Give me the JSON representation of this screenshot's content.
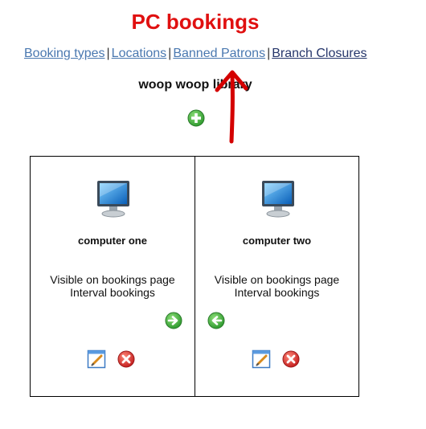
{
  "page": {
    "title": "PC bookings",
    "library_name": "woop woop library"
  },
  "nav": {
    "links": [
      {
        "label": "Booking types"
      },
      {
        "label": "Locations"
      },
      {
        "label": "Banned Patrons"
      },
      {
        "label": "Branch Closures"
      }
    ],
    "separator": "|"
  },
  "colors": {
    "title": "#e01010",
    "link": "#4a78b0",
    "link_visited": "#26366b",
    "add_green": "#3aa63a",
    "delete_red": "#d42a2a",
    "annotation_arrow": "#d40000"
  },
  "icons": {
    "add": "plus-circle-icon",
    "monitor": "computer-monitor-icon",
    "move_right": "arrow-right-circle-icon",
    "move_left": "arrow-left-circle-icon",
    "edit": "edit-pencil-icon",
    "delete": "delete-x-icon"
  },
  "computers": [
    {
      "name": "computer one",
      "info_lines": [
        "Visible on bookings page",
        "Interval bookings"
      ]
    },
    {
      "name": "computer two",
      "info_lines": [
        "Visible on bookings page",
        "Interval bookings"
      ]
    }
  ]
}
